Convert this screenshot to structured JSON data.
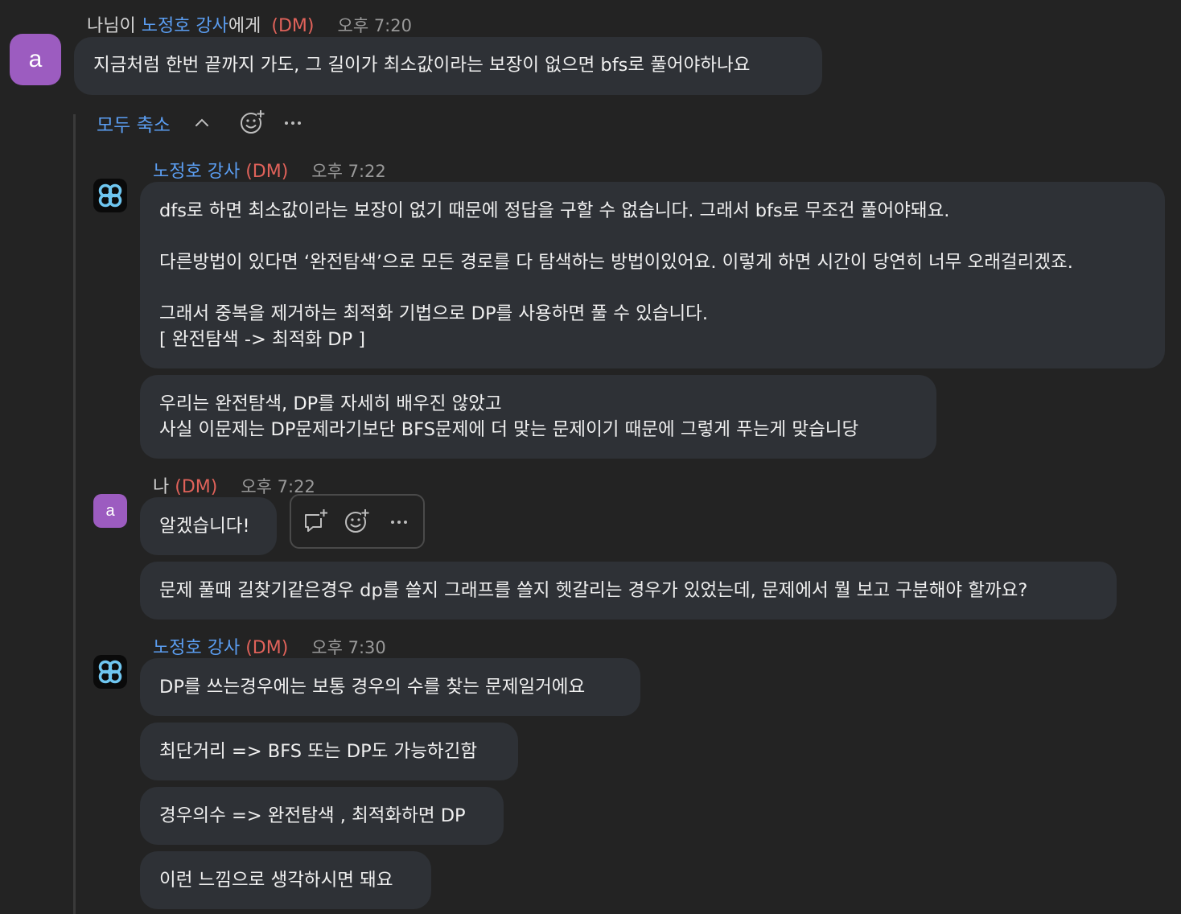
{
  "colors": {
    "background": "#232323",
    "bubble": "#2e3136",
    "link_blue": "#5b9ef2",
    "dm_red": "#e0625a",
    "avatar_purple": "#9c5cc0"
  },
  "root_message": {
    "header_prefix": "나님이 ",
    "recipient": "노정호 강사",
    "header_suffix": "에게",
    "dm_tag": "(DM)",
    "time": "오후 7:20",
    "avatar_letter": "a",
    "text": "지금처럼 한번 끝까지 가도, 그 길이가 최소값이라는 보장이 없으면 bfs로 풀어야하나요"
  },
  "thread_controls": {
    "collapse_all_label": "모두 축소",
    "chevron_icon": "chevron-up-icon",
    "react_icon": "add-emoji-icon",
    "more_icon": "more-horizontal-icon"
  },
  "thread": [
    {
      "sender": "노정호 강사",
      "dm_tag": "(DM)",
      "time": "오후 7:22",
      "messages": [
        {
          "lines": [
            "dfs로 하면 최소값이라는 보장이 없기 때문에 정답을 구할 수 없습니다. 그래서 bfs로 무조건 풀어야돼요.",
            "",
            "다른방법이 있다면 ‘완전탐색’으로 모든 경로를 다 탐색하는 방법이있어요. 이렇게 하면 시간이 당연히 너무 오래걸리겠죠.",
            "",
            "그래서 중복을 제거하는 최적화 기법으로 DP를 사용하면 풀 수 있습니다.",
            "[ 완전탐색 -> 최적화 DP ]"
          ]
        },
        {
          "lines": [
            "우리는 완전탐색, DP를 자세히 배우진 않았고",
            "사실 이문제는 DP문제라기보단 BFS문제에 더 맞는 문제이기 때문에 그렇게 푸는게 맞습니당"
          ]
        }
      ]
    },
    {
      "sender": "나",
      "dm_tag": "(DM)",
      "time": "오후 7:22",
      "avatar_letter": "a",
      "messages": [
        {
          "lines": [
            "알겠습니다!"
          ]
        },
        {
          "lines": [
            "문제 풀때 길찾기같은경우 dp를 쓸지 그래프를 쓸지 헷갈리는 경우가 있었는데, 문제에서 뭘 보고 구분해야 할까요?"
          ]
        }
      ]
    },
    {
      "sender": "노정호 강사",
      "dm_tag": "(DM)",
      "time": "오후 7:30",
      "messages": [
        {
          "lines": [
            "DP를 쓰는경우에는 보통 경우의 수를 찾는 문제일거에요"
          ]
        },
        {
          "lines": [
            "최단거리 => BFS 또는 DP도 가능하긴함"
          ]
        },
        {
          "lines": [
            "경우의수 => 완전탐색 , 최적화하면 DP"
          ]
        },
        {
          "lines": [
            "이런 느낌으로 생각하시면 돼요"
          ]
        }
      ]
    }
  ],
  "hover_toolbar": {
    "reply_icon": "reply-thread-icon",
    "react_icon": "add-emoji-icon",
    "more_icon": "more-horizontal-icon"
  }
}
